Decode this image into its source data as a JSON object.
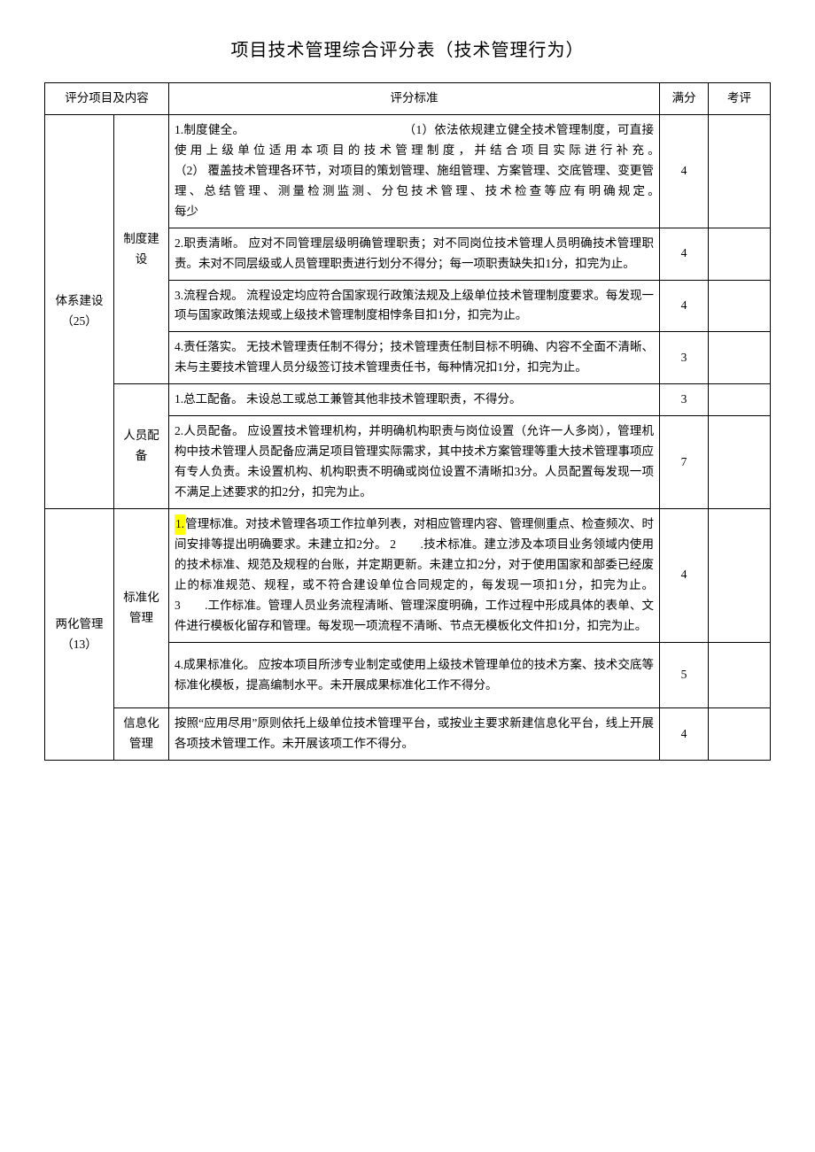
{
  "title": "项目技术管理综合评分表（技术管理行为）",
  "headers": {
    "item": "评分项目及内容",
    "criteria": "评分标准",
    "full": "满分",
    "eval": "考评"
  },
  "groups": [
    {
      "category": "体系建设（25）",
      "subgroups": [
        {
          "name": "制度建设",
          "rows": [
            {
              "text": "1.制度健全。　　　　　　　　　　　　　　（1）依法依规建立健全技术管理制度，可直接使用上级单位适用本项目的技术管理制度，并结合项目实际进行补充。　　　　　　　　　　　　　（2）\n覆盖技术管理各环节，对项目的策划管理、施组管理、方案管理、交底管理、变更管理、总结管理、测量检测监测、分包技术管理、技术检查等应有明确规定。　　　　　　　　　　　　　　　　每少",
              "score": "4"
            },
            {
              "text": "2.职责清晰。\n应对不同管理层级明确管理职责；对不同岗位技术管理人员明确技术管理职责。未对不同层级或人员管理职责进行划分不得分；每一项职责缺失扣1分，扣完为止。",
              "score": "4"
            },
            {
              "text": "3.流程合规。\n流程设定均应符合国家现行政策法规及上级单位技术管理制度要求。每发现一项与国家政策法规或上级技术管理制度相悖条目扣1分，扣完为止。",
              "score": "4"
            },
            {
              "text": "4.责任落实。\n无技术管理责任制不得分；技术管理责任制目标不明确、内容不全面不清晰、未与主要技术管理人员分级签订技术管理责任书，每种情况扣1分，扣完为止。",
              "score": "3"
            }
          ]
        },
        {
          "name": "人员配备",
          "rows": [
            {
              "text": "1.总工配备。\n未设总工或总工兼管其他非技术管理职责，不得分。",
              "score": "3"
            },
            {
              "text": "2.人员配备。\n应设置技术管理机构，并明确机构职责与岗位设置（允许一人多岗），管理机构中技术管理人员配备应满足项目管理实际需求，其中技术方案管理等重大技术管理事项应有专人负责。未设置机构、机构职责不明确或岗位设置不清晰扣3分。人员配置每发现一项不满足上述要求的扣2分，扣完为止。",
              "score": "7"
            }
          ]
        }
      ]
    },
    {
      "category": "两化管理（13）",
      "subgroups": [
        {
          "name": "标准化管理",
          "rows": [
            {
              "highlight_prefix": "1.",
              "text": "管理标准。对技术管理各项工作拉单列表，对相应管理内容、管理侧重点、检查频次、时间安排等提出明确要求。未建立扣2分。\n2　　.技术标准。建立涉及本项目业务领域内使用的技术标准、规范及规程的台账，并定期更新。未建立扣2分，对于使用国家和部委已经废止的标准规范、规程，或不符合建设单位合同规定的，每发现一项扣1分，扣完为止。\n3　　.工作标准。管理人员业务流程清晰、管理深度明确，工作过程中形成具体的表单、文件进行模板化留存和管理。每发现一项流程不清晰、节点无模板化文件扣1分，扣完为止。",
              "score": "4"
            },
            {
              "text": "4.成果标准化。\n应按本项目所涉专业制定或使用上级技术管理单位的技术方案、技术交底等标准化模板，提高编制水平。未开展成果标准化工作不得分。",
              "score": "5"
            }
          ]
        },
        {
          "name": "信息化管理",
          "rows": [
            {
              "text": "按照“应用尽用”原则依托上级单位技术管理平台，或按业主要求新建信息化平台，线上开展各项技术管理工作。未开展该项工作不得分。",
              "score": "4"
            }
          ]
        }
      ]
    }
  ]
}
